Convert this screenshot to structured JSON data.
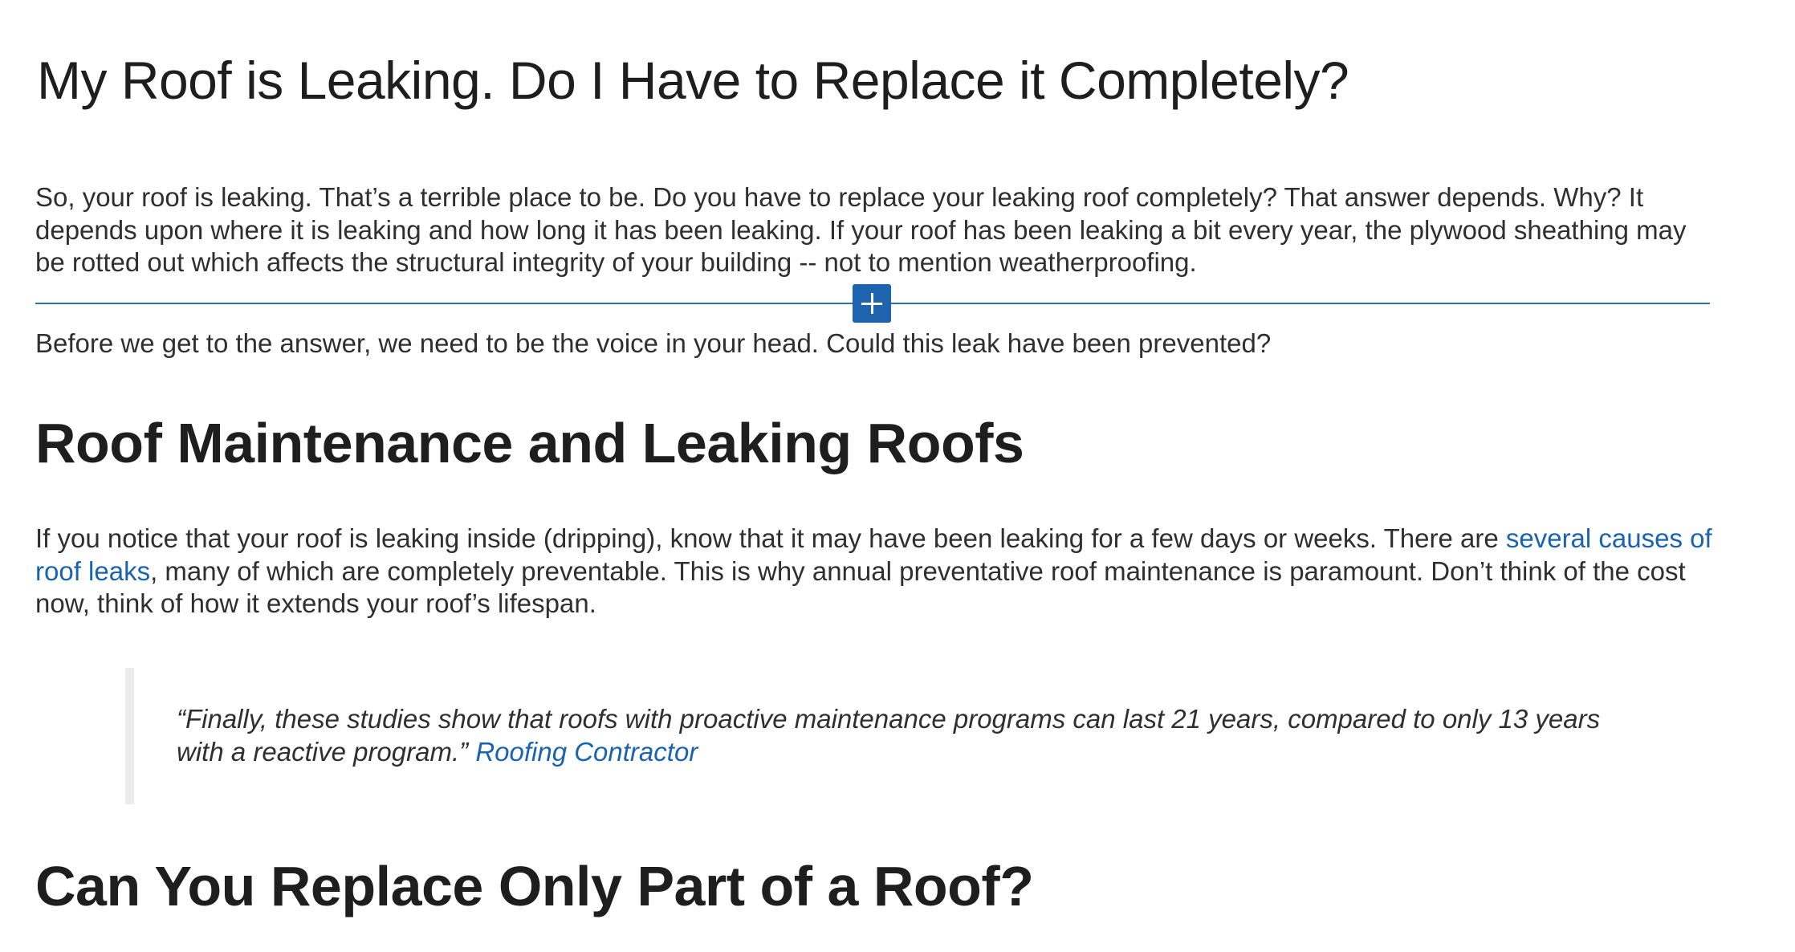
{
  "post": {
    "title": "My Roof is Leaking. Do I Have to Replace it Completely?",
    "intro_paragraph": "So, your roof is leaking. That’s a terrible place to be. Do you have to replace your leaking roof completely? That answer depends. Why? It depends upon where it is leaking and how long it has been leaking. If your roof has been leaking a bit every year, the plywood sheathing may be rotted out which affects the structural integrity of your building -- not to mention weatherproofing.",
    "voice_paragraph": "Before we get to the answer, we need to be the voice in your head. Could this leak have been prevented?",
    "heading_maintenance": "Roof Maintenance and Leaking Roofs",
    "maintenance_paragraph": {
      "before_link": "If you notice that your roof is leaking inside (dripping), know that it may have been leaking for a few days or weeks. There are ",
      "link_text": "several causes of roof leaks",
      "after_link": ", many of which are completely preventable. This is why annual preventative roof maintenance is paramount. Don’t think of the cost now, think of how it extends your roof’s lifespan."
    },
    "quote": {
      "text": "“Finally, these studies show that roofs with proactive maintenance programs can last 21 years, compared to only 13 years with a reactive program.” ",
      "source_link": "Roofing Contractor"
    },
    "heading_replace_part": "Can You Replace Only Part of a Roof?"
  },
  "inserter": {
    "icon": "plus-icon"
  },
  "colors": {
    "link": "#1a63b0",
    "inserter_accent": "#1e63ad",
    "text": "#2f2f2f",
    "quote_border": "#ececec"
  }
}
